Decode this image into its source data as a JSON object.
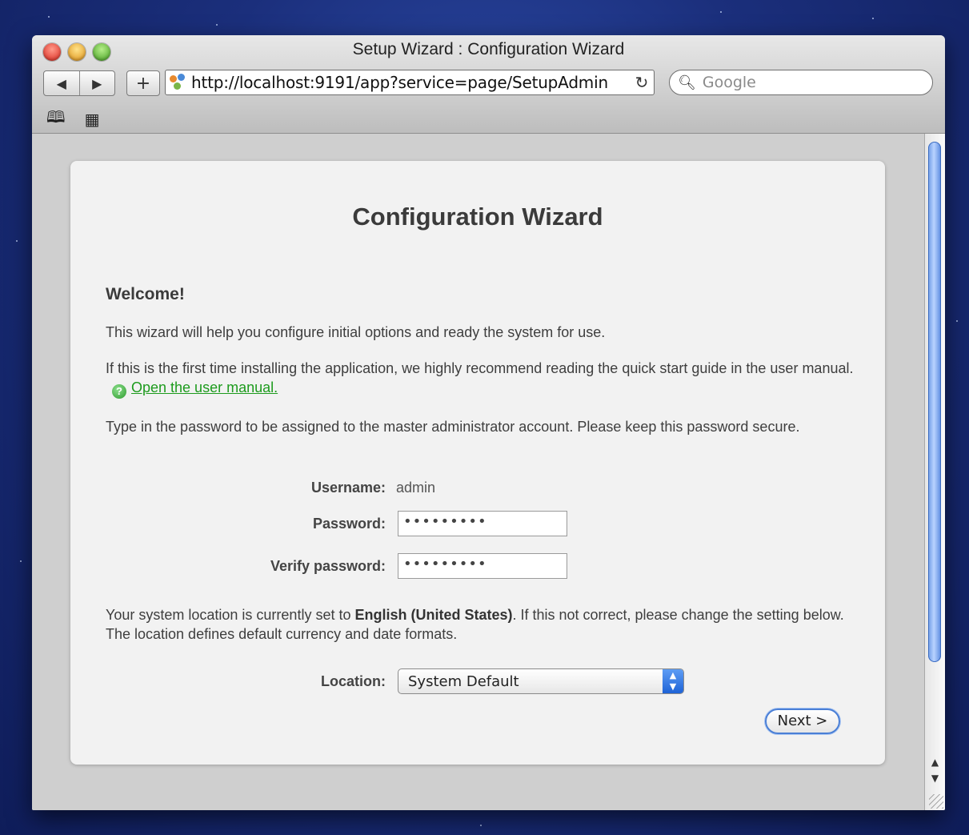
{
  "window": {
    "title": "Setup Wizard : Configuration Wizard"
  },
  "toolbar": {
    "back_icon": "back-arrow-icon",
    "forward_icon": "forward-arrow-icon",
    "add_label": "+",
    "url": "http://localhost:9191/app?service=page/SetupAdmin",
    "reload_icon": "reload-icon",
    "search_placeholder": "Google"
  },
  "bookmarks": {
    "items": [
      "book-icon",
      "grid-icon"
    ]
  },
  "page": {
    "heading": "Configuration Wizard",
    "welcome": "Welcome!",
    "intro": "This wizard will help you configure initial options and ready the system for use.",
    "manual_text": "If this is the first time installing the application, we highly recommend reading the quick start guide in the user manual.",
    "manual_link": "Open the user manual.",
    "password_text": "Type in the password to be assigned to the master administrator account. Please keep this password secure.",
    "username_label": "Username:",
    "username_value": "admin",
    "password_label": "Password:",
    "password_value": "•••••••••",
    "verify_label": "Verify password:",
    "verify_value": "•••••••••",
    "location_text_pre": "Your system location is currently set to ",
    "location_current": "English (United States)",
    "location_text_post": ". If this not correct, please change the setting below. The location defines default currency and date formats.",
    "location_label": "Location:",
    "location_value": "System Default",
    "next_label": "Next >"
  },
  "colors": {
    "link": "#1d9b1d",
    "accent": "#4a7fd6"
  }
}
